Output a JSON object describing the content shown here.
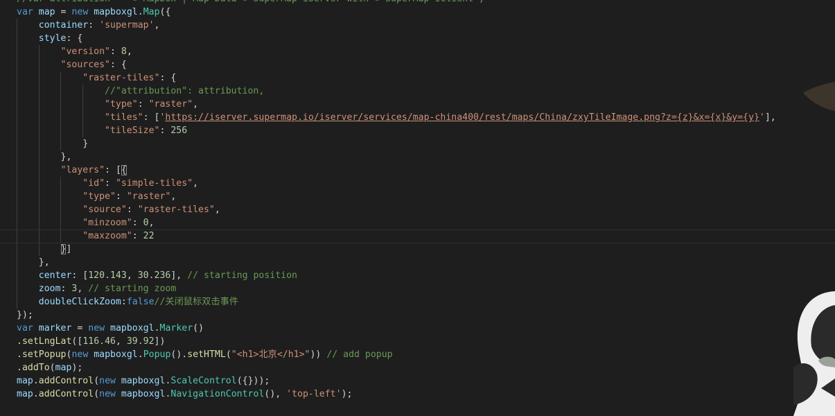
{
  "editor": {
    "theme": "dark",
    "colors": {
      "background": "#1e1e1e",
      "text": "#d4d4d4",
      "keyword": "#569cd6",
      "variable": "#9cdcfe",
      "function": "#dcdcaa",
      "class": "#4ec9b0",
      "string": "#ce9178",
      "number": "#b5cea8",
      "comment": "#6a9955"
    },
    "current_line": 18,
    "lines": [
      [
        [
          "cm",
          "//var attribution = \"© Mapbox | Map Data © SuperMap iServer with © SuperMap iClient\";"
        ]
      ],
      [
        [
          "kw",
          "var"
        ],
        [
          "pu",
          " "
        ],
        [
          "vr",
          "map"
        ],
        [
          "pu",
          " = "
        ],
        [
          "kw",
          "new"
        ],
        [
          "pu",
          " "
        ],
        [
          "vr",
          "mapboxgl"
        ],
        [
          "pu",
          "."
        ],
        [
          "cl",
          "Map"
        ],
        [
          "pu",
          "({"
        ]
      ],
      [
        [
          "pu",
          "    "
        ],
        [
          "vr",
          "container"
        ],
        [
          "pu",
          ": "
        ],
        [
          "st",
          "'supermap'"
        ],
        [
          "pu",
          ","
        ]
      ],
      [
        [
          "pu",
          "    "
        ],
        [
          "vr",
          "style"
        ],
        [
          "pu",
          ": {"
        ]
      ],
      [
        [
          "pu",
          "        "
        ],
        [
          "st",
          "\"version\""
        ],
        [
          "pu",
          ": "
        ],
        [
          "nm",
          "8"
        ],
        [
          "pu",
          ","
        ]
      ],
      [
        [
          "pu",
          "        "
        ],
        [
          "st",
          "\"sources\""
        ],
        [
          "pu",
          ": {"
        ]
      ],
      [
        [
          "pu",
          "            "
        ],
        [
          "st",
          "\"raster-tiles\""
        ],
        [
          "pu",
          ": {"
        ]
      ],
      [
        [
          "pu",
          "                "
        ],
        [
          "cm",
          "//\"attribution\": attribution,"
        ]
      ],
      [
        [
          "pu",
          "                "
        ],
        [
          "st",
          "\"type\""
        ],
        [
          "pu",
          ": "
        ],
        [
          "st",
          "\"raster\""
        ],
        [
          "pu",
          ","
        ]
      ],
      [
        [
          "pu",
          "                "
        ],
        [
          "st",
          "\"tiles\""
        ],
        [
          "pu",
          ": ["
        ],
        [
          "st",
          "'"
        ],
        [
          "st ln",
          "https://iserver.supermap.io/iserver/services/map-china400/rest/maps/China/zxyTileImage.png?z={z}&x={x}&y={y}"
        ],
        [
          "st",
          "'"
        ],
        [
          "pu",
          "],"
        ]
      ],
      [
        [
          "pu",
          "                "
        ],
        [
          "st",
          "\"tileSize\""
        ],
        [
          "pu",
          ": "
        ],
        [
          "nm",
          "256"
        ]
      ],
      [
        [
          "pu",
          "            }"
        ]
      ],
      [
        [
          "pu",
          "        },"
        ]
      ],
      [
        [
          "pu",
          "        "
        ],
        [
          "st",
          "\"layers\""
        ],
        [
          "pu",
          ": ["
        ],
        [
          "pu bm",
          "{"
        ]
      ],
      [
        [
          "pu",
          "            "
        ],
        [
          "st",
          "\"id\""
        ],
        [
          "pu",
          ": "
        ],
        [
          "st",
          "\"simple-tiles\""
        ],
        [
          "pu",
          ","
        ]
      ],
      [
        [
          "pu",
          "            "
        ],
        [
          "st",
          "\"type\""
        ],
        [
          "pu",
          ": "
        ],
        [
          "st",
          "\"raster\""
        ],
        [
          "pu",
          ","
        ]
      ],
      [
        [
          "pu",
          "            "
        ],
        [
          "st",
          "\"source\""
        ],
        [
          "pu",
          ": "
        ],
        [
          "st",
          "\"raster-tiles\""
        ],
        [
          "pu",
          ","
        ]
      ],
      [
        [
          "pu",
          "            "
        ],
        [
          "st",
          "\"minzoom\""
        ],
        [
          "pu",
          ": "
        ],
        [
          "nm",
          "0"
        ],
        [
          "pu",
          ","
        ]
      ],
      [
        [
          "pu",
          "            "
        ],
        [
          "st",
          "\"maxzoom\""
        ],
        [
          "pu",
          ": "
        ],
        [
          "nm",
          "22"
        ]
      ],
      [
        [
          "pu",
          "        "
        ],
        [
          "pu bm",
          "}"
        ],
        [
          "pu",
          "]"
        ]
      ],
      [
        [
          "pu",
          "    },"
        ]
      ],
      [
        [
          "pu",
          "    "
        ],
        [
          "vr",
          "center"
        ],
        [
          "pu",
          ": ["
        ],
        [
          "nm",
          "120.143"
        ],
        [
          "pu",
          ", "
        ],
        [
          "nm",
          "30.236"
        ],
        [
          "pu",
          "], "
        ],
        [
          "cm",
          "// starting position"
        ]
      ],
      [
        [
          "pu",
          "    "
        ],
        [
          "vr",
          "zoom"
        ],
        [
          "pu",
          ": "
        ],
        [
          "nm",
          "3"
        ],
        [
          "pu",
          ", "
        ],
        [
          "cm",
          "// starting zoom"
        ]
      ],
      [
        [
          "pu",
          "    "
        ],
        [
          "vr",
          "doubleClickZoom"
        ],
        [
          "pu",
          ":"
        ],
        [
          "kw",
          "false"
        ],
        [
          "cm",
          "//关闭鼠标双击事件"
        ]
      ],
      [
        [
          "pu",
          "});"
        ]
      ],
      [
        [
          "kw",
          "var"
        ],
        [
          "pu",
          " "
        ],
        [
          "vr",
          "marker"
        ],
        [
          "pu",
          " = "
        ],
        [
          "kw",
          "new"
        ],
        [
          "pu",
          " "
        ],
        [
          "vr",
          "mapboxgl"
        ],
        [
          "pu",
          "."
        ],
        [
          "cl",
          "Marker"
        ],
        [
          "pu",
          "()"
        ]
      ],
      [
        [
          "pu",
          "."
        ],
        [
          "fn",
          "setLngLat"
        ],
        [
          "pu",
          "(["
        ],
        [
          "nm",
          "116.46"
        ],
        [
          "pu",
          ", "
        ],
        [
          "nm",
          "39.92"
        ],
        [
          "pu",
          "])"
        ]
      ],
      [
        [
          "pu",
          "."
        ],
        [
          "fn",
          "setPopup"
        ],
        [
          "pu",
          "("
        ],
        [
          "kw",
          "new"
        ],
        [
          "pu",
          " "
        ],
        [
          "vr",
          "mapboxgl"
        ],
        [
          "pu",
          "."
        ],
        [
          "cl",
          "Popup"
        ],
        [
          "pu",
          "()."
        ],
        [
          "fn",
          "setHTML"
        ],
        [
          "pu",
          "("
        ],
        [
          "st",
          "\"<h1>北京</h1>\""
        ],
        [
          "pu",
          ")) "
        ],
        [
          "cm",
          "// add popup"
        ]
      ],
      [
        [
          "pu",
          "."
        ],
        [
          "fn",
          "addTo"
        ],
        [
          "pu",
          "("
        ],
        [
          "vr",
          "map"
        ],
        [
          "pu",
          ");"
        ]
      ],
      [
        [
          "vr",
          "map"
        ],
        [
          "pu",
          "."
        ],
        [
          "fn",
          "addControl"
        ],
        [
          "pu",
          "("
        ],
        [
          "kw",
          "new"
        ],
        [
          "pu",
          " "
        ],
        [
          "vr",
          "mapboxgl"
        ],
        [
          "pu",
          "."
        ],
        [
          "cl",
          "ScaleControl"
        ],
        [
          "pu",
          "({}));"
        ]
      ],
      [
        [
          "vr",
          "map"
        ],
        [
          "pu",
          "."
        ],
        [
          "fn",
          "addControl"
        ],
        [
          "pu",
          "("
        ],
        [
          "kw",
          "new"
        ],
        [
          "pu",
          " "
        ],
        [
          "vr",
          "mapboxgl"
        ],
        [
          "pu",
          "."
        ],
        [
          "cl",
          "NavigationControl"
        ],
        [
          "pu",
          "(), "
        ],
        [
          "st",
          "'top-left'"
        ],
        [
          "pu",
          ");"
        ]
      ]
    ]
  },
  "decoration": {
    "icon": "panda-mascot-icon",
    "colors": {
      "face": "#eeeeee",
      "dark": "#2a2a2a"
    }
  }
}
